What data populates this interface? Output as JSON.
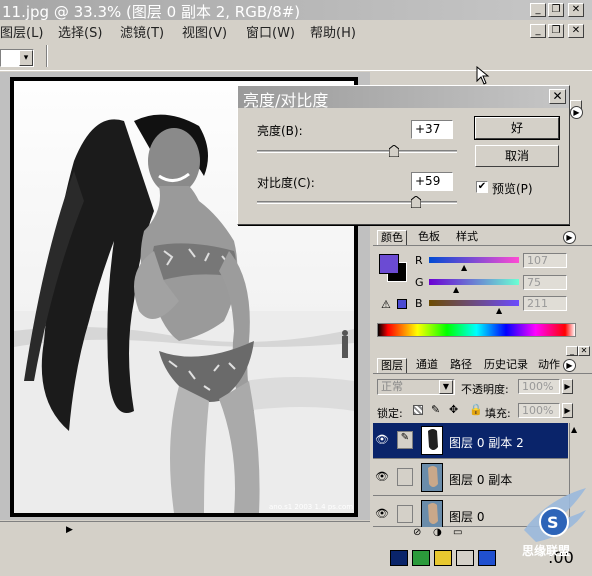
{
  "window": {
    "title": "11.jpg @ 33.3% (图层 0 副本 2, RGB/8#)",
    "minimize_label": "_",
    "maximize_label": "❐",
    "close_label": "✕"
  },
  "menu": [
    "图层(L)",
    "选择(S)",
    "滤镜(T)",
    "视图(V)",
    "窗口(W)",
    "帮助(H)"
  ],
  "toolbar": {
    "dropdown_arrow": "▾"
  },
  "photo": {
    "caption": "ano.s1 2003 1.4 ps.com"
  },
  "dialog": {
    "title": "亮度/对比度",
    "close_label": "✕",
    "brightness_label": "亮度(B):",
    "brightness_value": "+37",
    "brightness_level": 0.685,
    "contrast_label": "对比度(C):",
    "contrast_value": "+59",
    "contrast_level": 0.795,
    "ok_label": "好",
    "cancel_label": "取消",
    "preview_label": "预览(P)",
    "preview_checked": true
  },
  "color_panel": {
    "tabs": [
      "颜色",
      "色板",
      "样式"
    ],
    "channels": [
      {
        "label": "R",
        "value": "107"
      },
      {
        "label": "G",
        "value": "75"
      },
      {
        "label": "B",
        "value": "211"
      }
    ],
    "foreground_color": "#6b4bd3",
    "background_color": "#000000"
  },
  "layers_panel": {
    "tabs": [
      "图层",
      "通道",
      "路径",
      "历史记录",
      "动作"
    ],
    "blend_mode": "正常",
    "opacity_label": "不透明度:",
    "opacity_value": "100%",
    "lock_label": "锁定:",
    "fill_label": "填充:",
    "fill_value": "100%",
    "layers": [
      {
        "name": "图层 0 副本 2",
        "selected": true
      },
      {
        "name": "图层 0 副本",
        "selected": false
      },
      {
        "name": "图层 0",
        "selected": false
      }
    ]
  },
  "watermark": {
    "text": "思缘联盟"
  },
  "taskbar": {
    "clock": ":00"
  },
  "colors": {
    "selection": "#0a246a",
    "title_active": "#a6a6a6"
  }
}
